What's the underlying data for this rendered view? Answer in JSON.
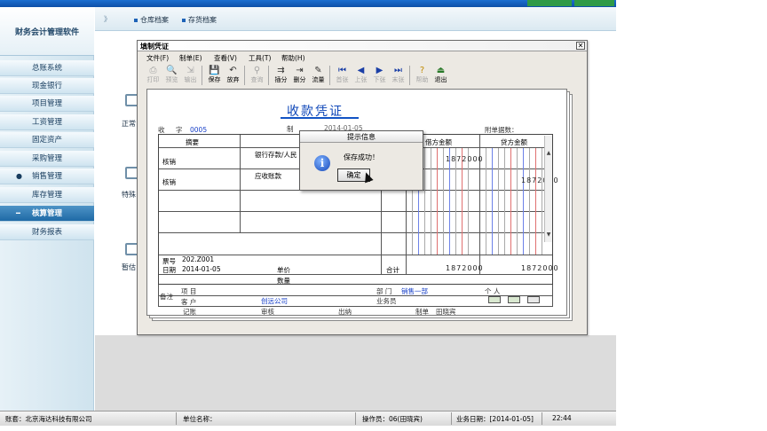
{
  "sidebar": {
    "logo": "财务会计管理软件",
    "items": [
      {
        "label": "总账系统"
      },
      {
        "label": "现金银行"
      },
      {
        "label": "项目管理"
      },
      {
        "label": "工资管理"
      },
      {
        "label": "固定资产"
      },
      {
        "label": "采购管理"
      },
      {
        "label": "销售管理"
      },
      {
        "label": "库存管理"
      },
      {
        "label": "核算管理"
      },
      {
        "label": "财务报表"
      }
    ],
    "active": "核算管理"
  },
  "tabs": {
    "separator": "》",
    "items": [
      {
        "label": "仓库档案"
      },
      {
        "label": "存货档案"
      }
    ]
  },
  "background_labels": [
    "正常",
    "特殊",
    "暂估"
  ],
  "window": {
    "title": "填制凭证",
    "menu": [
      "文件(F)",
      "制单(E)",
      "查看(V)",
      "工具(T)",
      "帮助(H)"
    ],
    "toolbar": [
      {
        "label": "打印",
        "icon": "printer-icon",
        "glyph": "⎙",
        "enabled": false
      },
      {
        "label": "预览",
        "icon": "preview-icon",
        "glyph": "🔍",
        "enabled": false
      },
      {
        "label": "输出",
        "icon": "export-icon",
        "glyph": "⇲",
        "enabled": false
      },
      {
        "label": "保存",
        "icon": "save-icon",
        "glyph": "💾",
        "enabled": true
      },
      {
        "label": "放弃",
        "icon": "undo-icon",
        "glyph": "↶",
        "enabled": true
      },
      {
        "label": "查询",
        "icon": "binoculars-icon",
        "glyph": "⚲",
        "enabled": false
      },
      {
        "label": "插分",
        "icon": "insert-entry-icon",
        "glyph": "⇉",
        "enabled": true
      },
      {
        "label": "删分",
        "icon": "delete-entry-icon",
        "glyph": "⇥",
        "enabled": true
      },
      {
        "label": "流量",
        "icon": "flow-icon",
        "glyph": "✎",
        "enabled": true
      },
      {
        "label": "首张",
        "icon": "first-record-icon",
        "glyph": "⏮",
        "enabled": false
      },
      {
        "label": "上张",
        "icon": "prev-record-icon",
        "glyph": "◀",
        "enabled": false
      },
      {
        "label": "下张",
        "icon": "next-record-icon",
        "glyph": "▶",
        "enabled": false
      },
      {
        "label": "末张",
        "icon": "last-record-icon",
        "glyph": "⏭",
        "enabled": false
      },
      {
        "label": "帮助",
        "icon": "help-icon",
        "glyph": "?",
        "enabled": false
      },
      {
        "label": "退出",
        "icon": "exit-icon",
        "glyph": "⏏",
        "enabled": true
      }
    ]
  },
  "voucher": {
    "title": "收款凭证",
    "type_label": "收",
    "number_label": "字",
    "number": "0005",
    "maker_label": "制",
    "date_partial": "2014-01-05",
    "attachments_label": "附单据数：",
    "headers": {
      "summary": "摘要",
      "debit": "借方金额",
      "credit": "贷方金额"
    },
    "rows": [
      {
        "summary": "核销",
        "account": "银行存款/人民",
        "debit": "1872000",
        "credit": ""
      },
      {
        "summary": "核销",
        "account": "应收账款",
        "debit": "",
        "credit": "1872000"
      },
      {
        "summary": "",
        "account": "",
        "debit": "",
        "credit": ""
      },
      {
        "summary": "",
        "account": "",
        "debit": "",
        "credit": ""
      }
    ],
    "ticket_label": "票号",
    "ticket_value": "202.Z001",
    "date_label": "日期",
    "date_value": "2014-01-05",
    "price_label": "单价",
    "qty_label": "数量",
    "total_label": "合计",
    "total_debit": "1872000",
    "total_credit": "1872000",
    "remark_label": "备注",
    "project_label": "项 目",
    "dept_label": "部 门",
    "dept_value": "销售一部",
    "person_label": "个 人",
    "customer_label": "客 户",
    "customer_value": "创远公司",
    "salesman_label": "业务员",
    "footer": {
      "bookkeeper": "记账",
      "auditor": "审核",
      "cashier": "出纳",
      "maker_label": "制单",
      "maker_value": "田晓宾"
    }
  },
  "dialog": {
    "title": "提示信息",
    "message": "保存成功！",
    "ok_label": "确定"
  },
  "status": {
    "account": "账套：北京海达科技有限公司",
    "unit": "单位名称：",
    "operator": "操作员：06(田晓宾)",
    "business_date": "业务日期：[2014-01-05]",
    "time": "22:44"
  },
  "colors": {
    "title_bar": "#0d4fa8",
    "voucher_title": "#0d46b8",
    "sidebar_active": "#1f6aa6",
    "top_right_button": "#2f9a47"
  }
}
